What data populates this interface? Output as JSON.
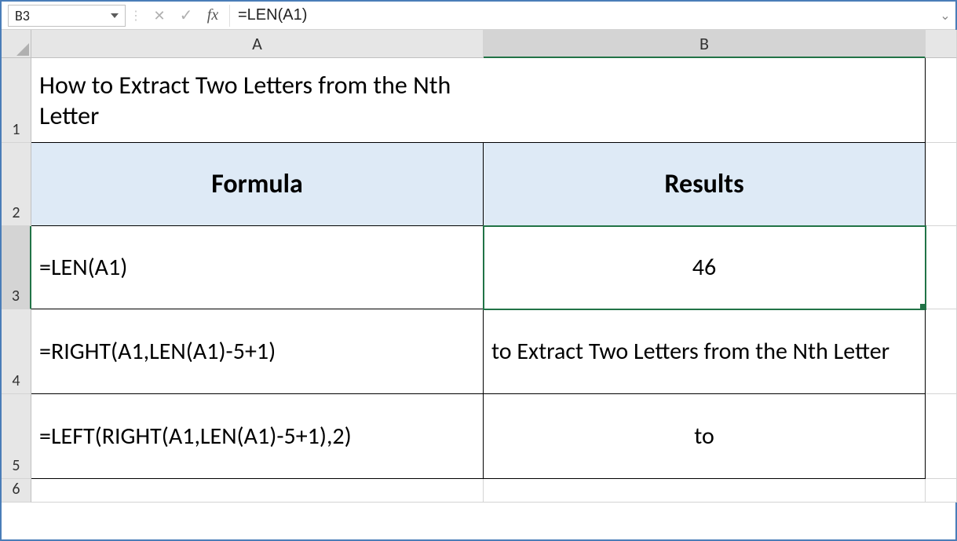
{
  "formula_bar": {
    "name_box": "B3",
    "fx_label": "fx",
    "formula": "=LEN(A1)"
  },
  "columns": {
    "A": "A",
    "B": "B"
  },
  "rows": {
    "r1": "1",
    "r2": "2",
    "r3": "3",
    "r4": "4",
    "r5": "5",
    "r6": "6"
  },
  "cells": {
    "A1": "How to Extract Two Letters from the Nth Letter",
    "A2": "Formula",
    "B2": "Results",
    "A3": "=LEN(A1)",
    "B3": "46",
    "A4": "=RIGHT(A1,LEN(A1)-5+1)",
    "B4": "to Extract Two Letters from the Nth Letter",
    "A5": "=LEFT(RIGHT(A1,LEN(A1)-5+1),2)",
    "B5": "to"
  }
}
